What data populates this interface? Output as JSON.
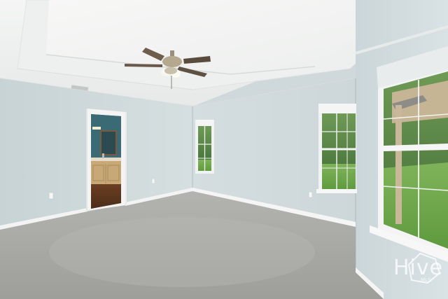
{
  "photo": {
    "watermark": {
      "brand_text": "Hive",
      "subtext": "MLS"
    }
  }
}
